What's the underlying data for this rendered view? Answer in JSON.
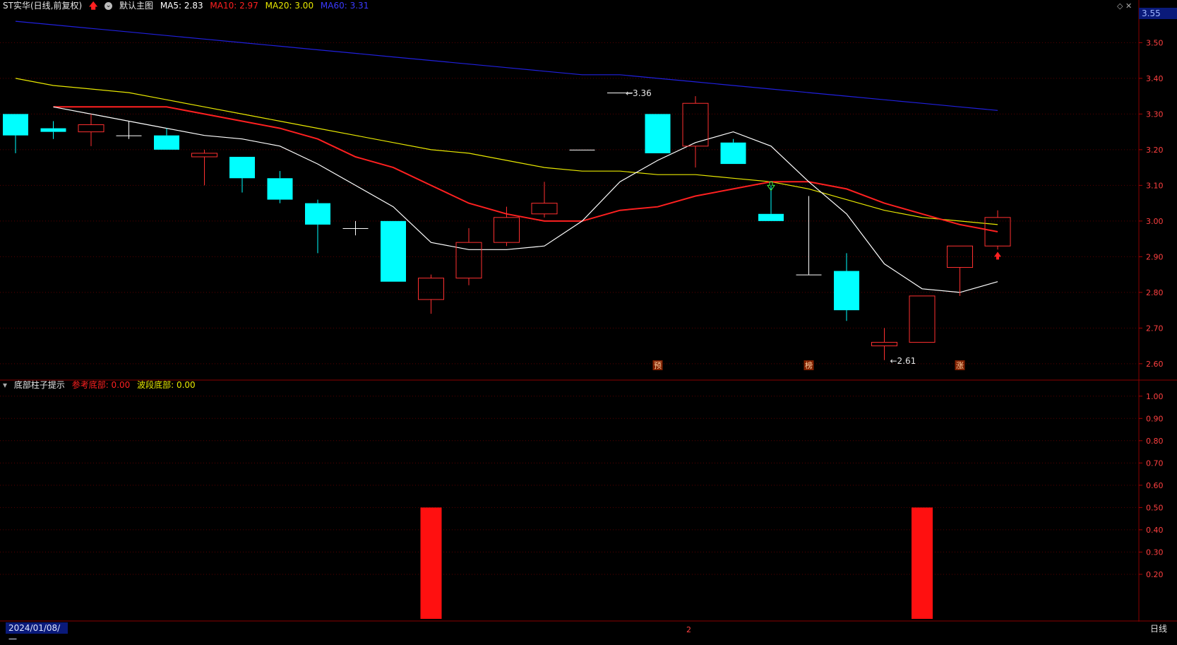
{
  "header": {
    "title": "ST实华(日线,前复权)",
    "template": "默认主图",
    "ma5_label": "MA5: 2.83",
    "ma10_label": "MA10: 2.97",
    "ma20_label": "MA20: 3.00",
    "ma60_label": "MA60: 3.31"
  },
  "sub_header": {
    "title": "底部柱子提示",
    "ref_bottom_label": "参考底部: 0.00",
    "wave_bottom_label": "波段底部: 0.00"
  },
  "axis": {
    "last_price": "3.55",
    "date_start": "2024/01/08/一",
    "period": "日线",
    "page_marker": "2"
  },
  "colors": {
    "up": "#ff3030",
    "down": "#00ffff",
    "ma5": "#ffffff",
    "ma10": "#ff2020",
    "ma20": "#e8e800",
    "ma60": "#2020dd",
    "grid": "#5a0000",
    "axis_text": "#ff4040"
  },
  "chart_data": [
    {
      "type": "candlestick",
      "title": "ST实华(日线,前复权)",
      "ylim": [
        2.57,
        3.58
      ],
      "y_ticks": [
        "3.50",
        "3.40",
        "3.30",
        "3.20",
        "3.10",
        "3.00",
        "2.90",
        "2.80",
        "2.70",
        "2.60"
      ],
      "candles": [
        {
          "o": 3.3,
          "h": 3.3,
          "l": 3.19,
          "c": 3.24
        },
        {
          "o": 3.26,
          "h": 3.28,
          "l": 3.23,
          "c": 3.25
        },
        {
          "o": 3.25,
          "h": 3.3,
          "l": 3.21,
          "c": 3.27
        },
        {
          "o": 3.24,
          "h": 3.28,
          "l": 3.23,
          "c": 3.24
        },
        {
          "o": 3.24,
          "h": 3.26,
          "l": 3.2,
          "c": 3.2
        },
        {
          "o": 3.18,
          "h": 3.2,
          "l": 3.1,
          "c": 3.19
        },
        {
          "o": 3.18,
          "h": 3.18,
          "l": 3.08,
          "c": 3.12
        },
        {
          "o": 3.12,
          "h": 3.14,
          "l": 3.05,
          "c": 3.06
        },
        {
          "o": 3.05,
          "h": 3.06,
          "l": 2.91,
          "c": 2.99
        },
        {
          "o": 2.98,
          "h": 3.0,
          "l": 2.96,
          "c": 2.98
        },
        {
          "o": 3.0,
          "h": 3.0,
          "l": 2.83,
          "c": 2.83
        },
        {
          "o": 2.78,
          "h": 2.85,
          "l": 2.74,
          "c": 2.84
        },
        {
          "o": 2.84,
          "h": 2.98,
          "l": 2.82,
          "c": 2.94
        },
        {
          "o": 2.94,
          "h": 3.04,
          "l": 2.93,
          "c": 3.01
        },
        {
          "o": 3.02,
          "h": 3.11,
          "l": 3.01,
          "c": 3.05
        },
        {
          "o": 3.2,
          "h": 3.2,
          "l": 3.2,
          "c": 3.2
        },
        {
          "o": 3.36,
          "h": 3.36,
          "l": 3.36,
          "c": 3.36
        },
        {
          "o": 3.3,
          "h": 3.3,
          "l": 3.19,
          "c": 3.19
        },
        {
          "o": 3.21,
          "h": 3.35,
          "l": 3.15,
          "c": 3.33
        },
        {
          "o": 3.22,
          "h": 3.23,
          "l": 3.16,
          "c": 3.16
        },
        {
          "o": 3.02,
          "h": 3.1,
          "l": 3.0,
          "c": 3.0
        },
        {
          "o": 2.85,
          "h": 3.07,
          "l": 2.85,
          "c": 2.85
        },
        {
          "o": 2.86,
          "h": 2.91,
          "l": 2.72,
          "c": 2.75
        },
        {
          "o": 2.65,
          "h": 2.7,
          "l": 2.61,
          "c": 2.66
        },
        {
          "o": 2.66,
          "h": 2.79,
          "l": 2.66,
          "c": 2.79
        },
        {
          "o": 2.87,
          "h": 2.93,
          "l": 2.79,
          "c": 2.93
        },
        {
          "o": 2.93,
          "h": 3.03,
          "l": 2.92,
          "c": 3.01
        }
      ],
      "ma5": [
        3.32,
        3.3,
        3.28,
        3.26,
        3.24,
        3.23,
        3.21,
        3.16,
        3.1,
        3.04,
        2.94,
        2.92,
        2.92,
        2.93,
        3.0,
        3.11,
        3.17,
        3.22,
        3.25,
        3.21,
        3.11,
        3.02,
        2.88,
        2.81,
        2.8,
        2.83
      ],
      "ma10": [
        3.32,
        3.32,
        3.32,
        3.32,
        3.3,
        3.28,
        3.26,
        3.23,
        3.18,
        3.15,
        3.1,
        3.05,
        3.02,
        3.0,
        3.0,
        3.03,
        3.04,
        3.07,
        3.09,
        3.11,
        3.11,
        3.09,
        3.05,
        3.02,
        2.99,
        2.97
      ],
      "ma20": [
        3.4,
        3.38,
        3.37,
        3.36,
        3.34,
        3.32,
        3.3,
        3.28,
        3.26,
        3.24,
        3.22,
        3.2,
        3.19,
        3.17,
        3.15,
        3.14,
        3.14,
        3.13,
        3.13,
        3.12,
        3.11,
        3.09,
        3.06,
        3.03,
        3.01,
        3.0,
        2.99
      ],
      "ma60": [
        3.56,
        3.55,
        3.54,
        3.53,
        3.52,
        3.51,
        3.5,
        3.49,
        3.48,
        3.47,
        3.46,
        3.45,
        3.44,
        3.43,
        3.42,
        3.41,
        3.41,
        3.4,
        3.39,
        3.38,
        3.37,
        3.36,
        3.35,
        3.34,
        3.33,
        3.32,
        3.31
      ],
      "annotations": [
        {
          "index": 16,
          "text": "3.36",
          "value": 3.36
        },
        {
          "index": 23,
          "text": "2.61",
          "value": 2.61
        }
      ],
      "markers": [
        {
          "index": 17,
          "text": "预"
        },
        {
          "index": 21,
          "text": "榜"
        },
        {
          "index": 25,
          "text": "涨"
        }
      ]
    },
    {
      "type": "bar",
      "title": "底部柱子提示",
      "ylim": [
        0,
        1.05
      ],
      "y_ticks": [
        "1.00",
        "0.90",
        "0.80",
        "0.70",
        "0.60",
        "0.50",
        "0.40",
        "0.30",
        "0.20"
      ],
      "bars": [
        {
          "index": 11,
          "value": 0.5
        },
        {
          "index": 24,
          "value": 0.5
        }
      ]
    }
  ]
}
